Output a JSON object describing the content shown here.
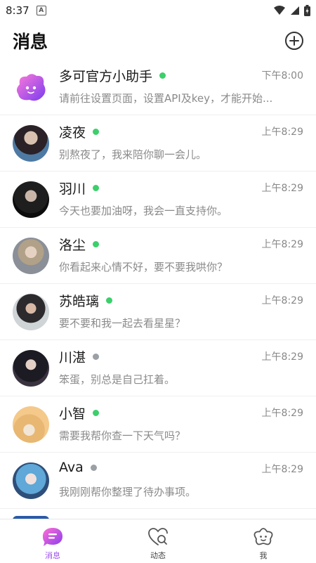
{
  "status_bar": {
    "time": "8:37",
    "notif_letter": "A"
  },
  "header": {
    "title": "消息"
  },
  "chats": [
    {
      "name": "多可官方小助手",
      "online": true,
      "time": "下午8:00",
      "preview": "请前往设置页面，设置API及key，才能开始...",
      "avatar": "blob"
    },
    {
      "name": "凌夜",
      "online": true,
      "time": "上午8:29",
      "preview": "别熬夜了，我来陪你聊一会儿。",
      "avatar": "portrait"
    },
    {
      "name": "羽川",
      "online": true,
      "time": "上午8:29",
      "preview": "今天也要加油呀，我会一直支持你。",
      "avatar": "portrait"
    },
    {
      "name": "洛尘",
      "online": true,
      "time": "上午8:29",
      "preview": "你看起来心情不好，要不要我哄你？",
      "avatar": "portrait"
    },
    {
      "name": "苏皓璃",
      "online": true,
      "time": "上午8:29",
      "preview": "要不要和我一起去看星星？",
      "avatar": "portrait"
    },
    {
      "name": "川湛",
      "online": false,
      "time": "上午8:29",
      "preview": "笨蛋，别总是自己扛着。",
      "avatar": "portrait"
    },
    {
      "name": "小智",
      "online": true,
      "time": "上午8:29",
      "preview": "需要我帮你查一下天气吗？",
      "avatar": "portrait"
    },
    {
      "name": "Ava",
      "online": false,
      "time": "上午8:29",
      "preview": "我刚刚帮你整理了待办事项。",
      "avatar": "portrait"
    }
  ],
  "tabs": [
    {
      "label": "消息",
      "icon": "chat-bubble-icon",
      "active": true
    },
    {
      "label": "动态",
      "icon": "heart-search-icon",
      "active": false
    },
    {
      "label": "我",
      "icon": "smiley-flower-icon",
      "active": false
    }
  ],
  "colors": {
    "accent": "#9a4cf0",
    "online": "#3ccf6b",
    "offline": "#9aa0a6"
  }
}
